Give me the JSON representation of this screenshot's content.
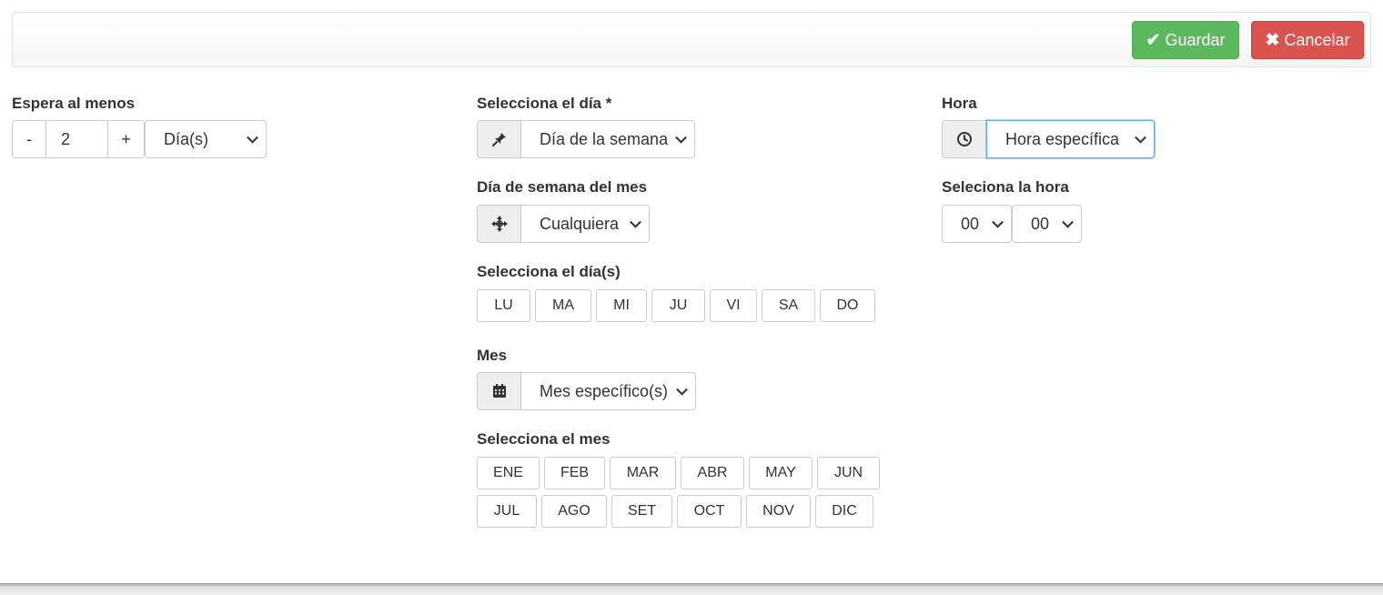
{
  "toolbar": {
    "save_label": "Guardar",
    "cancel_label": "Cancelar"
  },
  "wait": {
    "label": "Espera al menos",
    "decrement": "-",
    "value": "2",
    "increment": "+",
    "unit": "Día(s)"
  },
  "day": {
    "label": "Selecciona el día *",
    "mode": "Día de la semana",
    "weekday_of_month_label": "Día de semana del mes",
    "weekday_of_month": "Cualquiera",
    "days_label": "Selecciona el día(s)",
    "days": [
      "LU",
      "MA",
      "MI",
      "JU",
      "VI",
      "SA",
      "DO"
    ]
  },
  "month": {
    "label": "Mes",
    "mode": "Mes específico(s)",
    "select_label": "Selecciona el mes",
    "months": [
      "ENE",
      "FEB",
      "MAR",
      "ABR",
      "MAY",
      "JUN",
      "JUL",
      "AGO",
      "SET",
      "OCT",
      "NOV",
      "DIC"
    ]
  },
  "time": {
    "label": "Hora",
    "mode": "Hora específica",
    "select_label": "Seleciona la hora",
    "hour": "00",
    "minute": "00"
  },
  "icons": {
    "save": "check-icon",
    "cancel": "x-icon",
    "day": "pin-icon",
    "weekday": "move-icon",
    "month": "calendar-icon",
    "time": "clock-icon"
  }
}
